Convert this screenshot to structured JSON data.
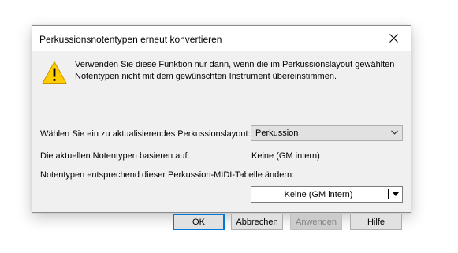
{
  "dialog": {
    "title": "Perkussionsnotentypen erneut konvertieren",
    "close_icon": "close-icon",
    "warning_icon": "warning-icon",
    "message": "Verwenden Sie diese Funktion nur dann, wenn die im Perkussionslayout gewählten Notentypen nicht mit dem gewünschten Instrument übereinstimmen.",
    "layout_label": "Wählen Sie ein zu aktualisierendes Perkussionslayout:",
    "layout_value": "Perkussion",
    "based_label": "Die aktuellen Notentypen basieren auf:",
    "based_value": "Keine (GM intern)",
    "midi_label": "Notentypen entsprechend dieser Perkussion-MIDI-Tabelle ändern:",
    "midi_value": "Keine (GM intern)",
    "buttons": {
      "ok": "OK",
      "cancel": "Abbrechen",
      "apply": "Anwenden",
      "help": "Hilfe"
    },
    "colors": {
      "accent": "#0078d7",
      "warning": "#ffcc00"
    }
  }
}
